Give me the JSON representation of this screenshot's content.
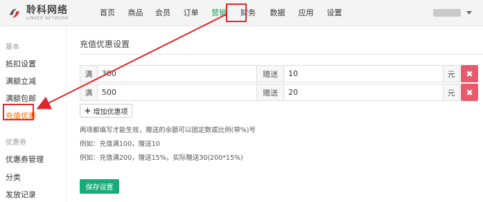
{
  "brand": {
    "title": "聆科网络",
    "subtitle": "LINKER NETWORK"
  },
  "nav": {
    "items": [
      {
        "label": "首页"
      },
      {
        "label": "商品"
      },
      {
        "label": "会员"
      },
      {
        "label": "订单"
      },
      {
        "label": "营销",
        "active": true
      },
      {
        "label": "财务"
      },
      {
        "label": "数据"
      },
      {
        "label": "应用"
      },
      {
        "label": "设置"
      }
    ]
  },
  "sidebar": {
    "groups": [
      {
        "title": "基本",
        "items": [
          {
            "label": "抵扣设置"
          },
          {
            "label": "满额立减"
          },
          {
            "label": "满额包邮"
          },
          {
            "label": "充值优惠",
            "active": true
          }
        ]
      },
      {
        "title": "优惠券",
        "items": [
          {
            "label": "优惠券管理"
          },
          {
            "label": "分类"
          },
          {
            "label": "发放记录"
          }
        ]
      }
    ]
  },
  "main": {
    "title": "充值优惠设置",
    "rows": [
      {
        "prefix": "满",
        "amount": "300",
        "mid": "赠送",
        "bonus": "10",
        "suffix": "元",
        "delete": "✖"
      },
      {
        "prefix": "满",
        "amount": "500",
        "mid": "赠送",
        "bonus": "20",
        "suffix": "元",
        "delete": "✖"
      }
    ],
    "add_label": "增加优惠项",
    "add_icon": "+",
    "help": [
      "两项都填写才能生效，赠送的余额可以固定数或比例(带%)号",
      "例如：充值满100，赠送10",
      "例如：充值满200，赠送15%，实际赠送30(200*15%)"
    ],
    "save_label": "保存设置"
  },
  "colors": {
    "accent_green": "#1aab7a",
    "active_orange": "#ff6a00",
    "annotation_red": "#e0262b",
    "delete_red": "#e75a6b"
  }
}
